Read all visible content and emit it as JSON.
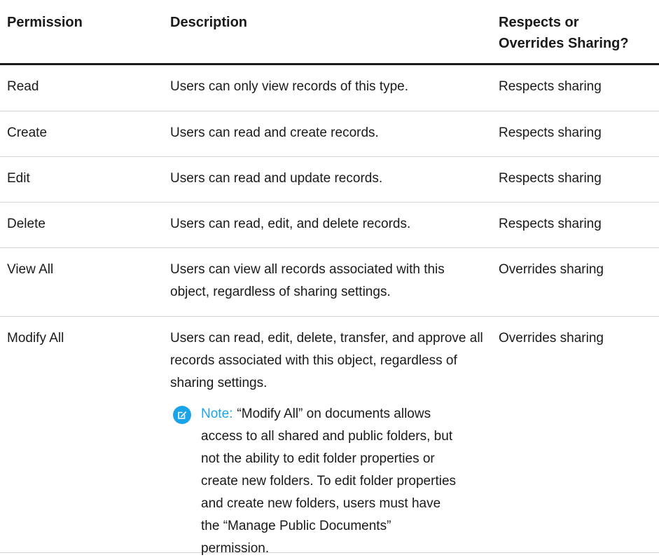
{
  "table": {
    "headers": {
      "permission": "Permission",
      "description": "Description",
      "sharing_line1": "Respects or",
      "sharing_line2": "Overrides Sharing?"
    },
    "rows": [
      {
        "permission": "Read",
        "description": "Users can only view records of this type.",
        "sharing": "Respects sharing"
      },
      {
        "permission": "Create",
        "description": "Users can read and create records.",
        "sharing": "Respects sharing"
      },
      {
        "permission": "Edit",
        "description": "Users can read and update records.",
        "sharing": "Respects sharing"
      },
      {
        "permission": "Delete",
        "description": "Users can read, edit, and delete records.",
        "sharing": "Respects sharing"
      },
      {
        "permission": "View All",
        "description": "Users can view all records associated with this object, regardless of sharing settings.",
        "sharing": "Overrides sharing"
      },
      {
        "permission": "Modify All",
        "description": "Users can read, edit, delete, transfer, and approve all records associated with this object, regardless of sharing settings.",
        "sharing": "Overrides sharing"
      }
    ],
    "note": {
      "label": "Note:",
      "text": "“Modify All” on documents allows access to all shared and public folders, but not the ability to edit folder properties or create new folders. To edit folder properties and create new folders, users must have the “Manage Public Documents” permission.",
      "icon": "edit-note-icon"
    }
  },
  "colors": {
    "accent": "#1ba5e8",
    "text": "#1a1a1a",
    "divider": "#d4d4d4"
  }
}
